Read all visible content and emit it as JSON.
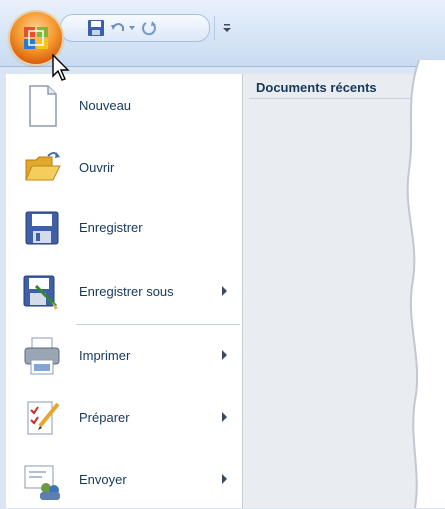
{
  "quick_access": {
    "save_icon": "save-icon",
    "undo_icon": "undo-icon",
    "redo_icon": "redo-icon",
    "customize_icon": "customize-dropdown-icon"
  },
  "office_button": {
    "icon": "office-logo-icon"
  },
  "menu": {
    "items": [
      {
        "label": "Nouveau",
        "icon": "new-document-icon",
        "submenu": false
      },
      {
        "label": "Ouvrir",
        "icon": "open-folder-icon",
        "submenu": false
      },
      {
        "label": "Enregistrer",
        "icon": "save-icon",
        "submenu": false
      },
      {
        "label": "Enregistrer sous",
        "icon": "save-as-icon",
        "submenu": true
      },
      {
        "label": "Imprimer",
        "icon": "printer-icon",
        "submenu": true
      },
      {
        "label": "Préparer",
        "icon": "prepare-icon",
        "submenu": true
      },
      {
        "label": "Envoyer",
        "icon": "send-icon",
        "submenu": true
      }
    ]
  },
  "recent_documents": {
    "title": "Documents récents"
  },
  "colors": {
    "accent": "#f28a1c",
    "label_text": "#15385c",
    "frame": "#dbe6f4"
  }
}
